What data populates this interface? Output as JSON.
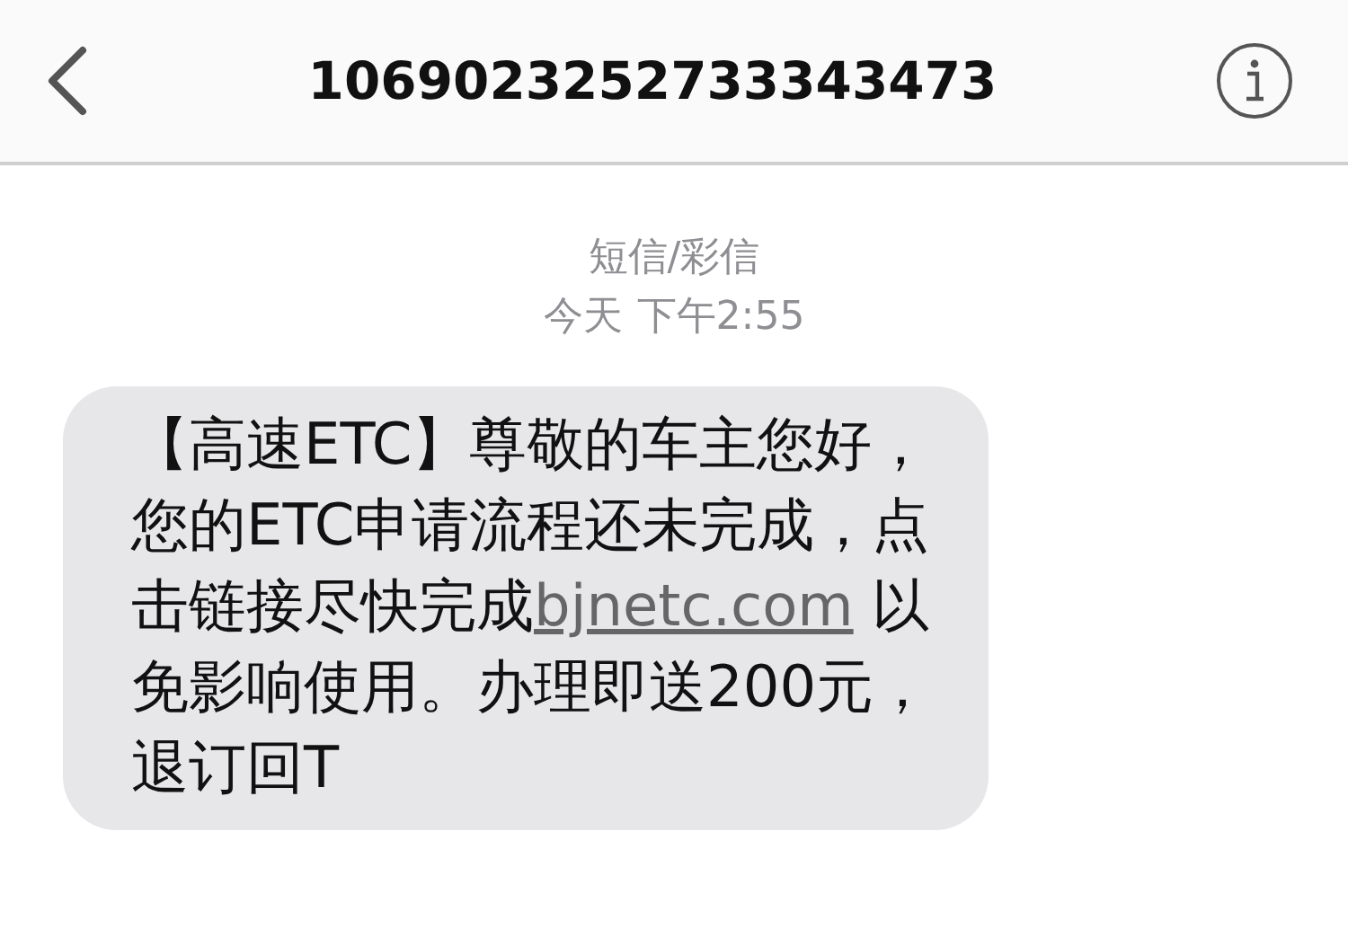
{
  "header": {
    "title": "1069023252733343473"
  },
  "thread": {
    "service": "短信/彩信",
    "day": "今天",
    "time": "下午2:55"
  },
  "message": {
    "before": "【高速ETC】尊敬的车主您好，您的ETC申请流程还未完成，点击链接尽快完成",
    "link": "bjnetc.com",
    "after": " 以免影响使用。办理即送200元，退订回T"
  }
}
